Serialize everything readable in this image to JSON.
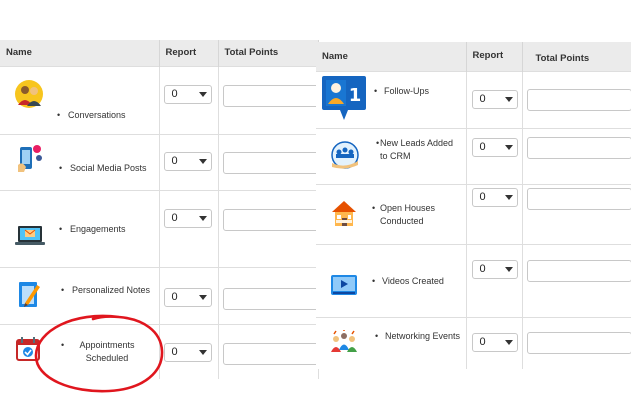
{
  "left_table": {
    "headers": {
      "name": "Name",
      "report": "Report",
      "total_points": "Total Points"
    },
    "rows": [
      {
        "label": "Conversations",
        "icon": "conversation-people-icon",
        "report": "0",
        "points": ""
      },
      {
        "label": "Social Media Posts",
        "icon": "social-media-phone-icon",
        "report": "0",
        "points": ""
      },
      {
        "label": "Engagements",
        "icon": "laptop-email-icon",
        "report": "0",
        "points": ""
      },
      {
        "label": "Personalized Notes",
        "icon": "notepad-pencil-icon",
        "report": "0",
        "points": ""
      },
      {
        "label": "Appointments Scheduled",
        "icon": "calendar-check-icon",
        "report": "0",
        "points": ""
      }
    ]
  },
  "right_table": {
    "headers": {
      "name": "Name",
      "report": "Report",
      "total_points": "Total Points"
    },
    "rows": [
      {
        "label": "Follow-Ups",
        "icon": "user-notification-icon",
        "report": "0",
        "points": ""
      },
      {
        "label": "New Leads Added to CRM",
        "icon": "leads-group-hand-icon",
        "report": "0",
        "points": ""
      },
      {
        "label": "Open Houses Conducted",
        "icon": "open-house-icon",
        "report": "0",
        "points": ""
      },
      {
        "label": "Videos Created",
        "icon": "video-play-icon",
        "report": "0",
        "points": ""
      },
      {
        "label": "Networking Events",
        "icon": "networking-people-icon",
        "report": "0",
        "points": ""
      }
    ]
  },
  "annotation": {
    "color": "#e0161e",
    "target": "Appointments Scheduled"
  }
}
